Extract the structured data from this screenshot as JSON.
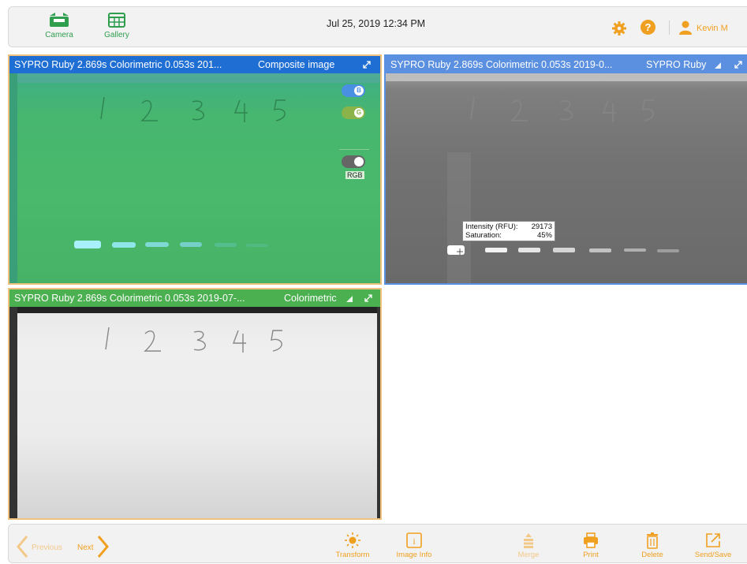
{
  "header": {
    "camera_label": "Camera",
    "gallery_label": "Gallery",
    "datetime": "Jul 25, 2019  12:34 PM",
    "user_name": "Kevin M",
    "help_symbol": "?"
  },
  "panels": [
    {
      "title": "SYPRO Ruby 2.869s Colorimetric 0.053s 201...",
      "mode": "Composite image",
      "toggles": [
        {
          "label": "B",
          "on": true,
          "color": "#4a90e2"
        },
        {
          "label": "G",
          "on": true,
          "color": "#8ab34a"
        }
      ],
      "rgb_label": "RGB"
    },
    {
      "title": "SYPRO Ruby 2.869s Colorimetric 0.053s 2019-0...",
      "mode": "SYPRO Ruby",
      "tooltip": {
        "intensity_label": "Intensity (RFU):",
        "intensity_value": "29173",
        "saturation_label": "Saturation:",
        "saturation_value": "45%"
      }
    },
    {
      "title": "SYPRO Ruby 2.869s Colorimetric 0.053s 2019-07-...",
      "mode": "Colorimetric"
    }
  ],
  "footer": {
    "previous_label": "Previous",
    "next_label": "Next",
    "tools": [
      {
        "label": "Transform",
        "icon": "sun-icon",
        "enabled": true
      },
      {
        "label": "Image Info",
        "icon": "info-icon",
        "enabled": true
      },
      {
        "label": "Merge",
        "icon": "merge-icon",
        "enabled": false
      },
      {
        "label": "Print",
        "icon": "printer-icon",
        "enabled": true
      },
      {
        "label": "Delete",
        "icon": "trash-icon",
        "enabled": true
      },
      {
        "label": "Send/Save",
        "icon": "export-icon",
        "enabled": true
      }
    ]
  },
  "colors": {
    "accent_orange": "#f0a020",
    "green": "#2f9e4f",
    "panel_blue": "#1f6ed4",
    "panel_light_blue": "#5b8fe0",
    "panel_green": "#4bb04f"
  }
}
